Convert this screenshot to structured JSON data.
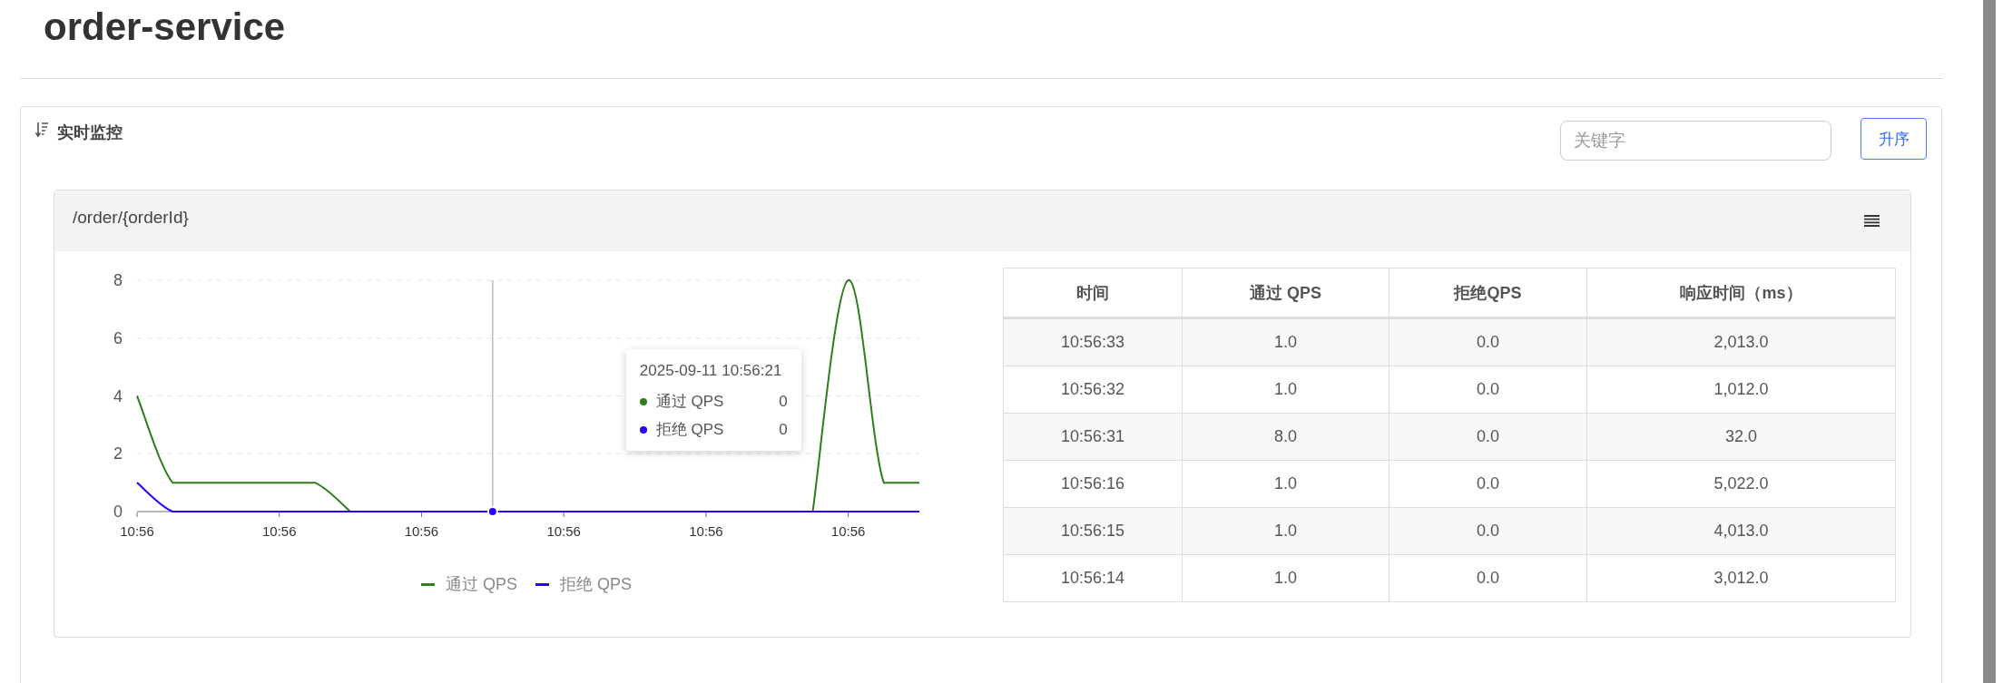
{
  "page": {
    "title": "order-service"
  },
  "panel": {
    "title": "实时监控",
    "search": {
      "placeholder": "关键字"
    },
    "sort_button": "升序"
  },
  "card": {
    "title": "/order/{orderId}",
    "chart_data": {
      "type": "line",
      "categories": [
        "10:56",
        null,
        null,
        null,
        "10:56",
        null,
        null,
        null,
        "10:56",
        null,
        null,
        null,
        "10:56",
        null,
        null,
        null,
        "10:56",
        null,
        null,
        null,
        "10:56",
        null,
        null
      ],
      "series": [
        {
          "name": "通过 QPS",
          "color": "#2f7d1f",
          "values": [
            4,
            1,
            1,
            1,
            1,
            1,
            0,
            null,
            null,
            null,
            null,
            null,
            null,
            null,
            null,
            null,
            null,
            null,
            null,
            0,
            8,
            1,
            1
          ]
        },
        {
          "name": "拒绝 QPS",
          "color": "#2a00ff",
          "values": [
            1,
            0,
            0,
            0,
            0,
            0,
            0,
            0,
            0,
            0,
            0,
            0,
            0,
            0,
            0,
            0,
            0,
            0,
            0,
            0,
            0,
            0,
            0
          ]
        }
      ],
      "ylim": [
        0,
        8
      ],
      "yticks": [
        0,
        2,
        4,
        6,
        8
      ],
      "grid": true,
      "legend": "bottom"
    },
    "tooltip": {
      "title": "2025-09-11 10:56:21",
      "rows": [
        {
          "label": "通过 QPS",
          "value": "0"
        },
        {
          "label": "拒绝 QPS",
          "value": "0"
        }
      ]
    },
    "table": {
      "columns": [
        "时间",
        "通过 QPS",
        "拒绝QPS",
        "响应时间（ms）"
      ],
      "rows": [
        [
          "10:56:33",
          "1.0",
          "0.0",
          "2,013.0"
        ],
        [
          "10:56:32",
          "1.0",
          "0.0",
          "1,012.0"
        ],
        [
          "10:56:31",
          "8.0",
          "0.0",
          "32.0"
        ],
        [
          "10:56:16",
          "1.0",
          "0.0",
          "5,022.0"
        ],
        [
          "10:56:15",
          "1.0",
          "0.0",
          "4,013.0"
        ],
        [
          "10:56:14",
          "1.0",
          "0.0",
          "3,012.0"
        ]
      ]
    }
  }
}
